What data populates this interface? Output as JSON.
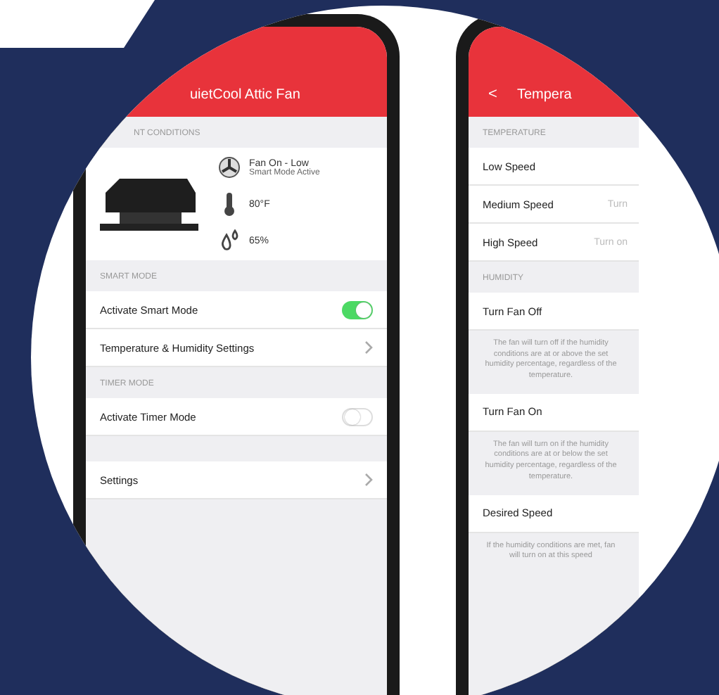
{
  "left_phone": {
    "title": "uietCool Attic Fan",
    "conditions": {
      "header": "NT CONDITIONS",
      "status": "Fan On - Low",
      "mode": "Smart Mode Active",
      "temperature": "80°F",
      "humidity": "65%"
    },
    "sections": [
      {
        "header": "SMART MODE",
        "rows": [
          {
            "kind": "toggle",
            "label": "Activate Smart Mode",
            "on": true
          },
          {
            "kind": "link",
            "label": "Temperature & Humidity Settings"
          }
        ]
      },
      {
        "header": "TIMER MODE",
        "rows": [
          {
            "kind": "toggle",
            "label": "Activate Timer Mode",
            "on": false
          }
        ]
      },
      {
        "rows": [
          {
            "kind": "link",
            "label": "Settings"
          }
        ]
      }
    ]
  },
  "right_phone": {
    "back": "<",
    "title": "Tempera",
    "sections": [
      {
        "header": "TEMPERATURE",
        "rows": [
          {
            "label": "Low Speed"
          },
          {
            "label": "Medium Speed",
            "value": "Turn"
          },
          {
            "label": "High Speed",
            "value": "Turn on"
          }
        ]
      },
      {
        "header": "HUMIDITY",
        "rows": [
          {
            "label": "Turn Fan Off",
            "note": "The fan will turn off if the humidity conditions are at or above the set humidity percentage, regardless of the temperature."
          },
          {
            "label": "Turn Fan On",
            "note": "The fan will turn on if the humidity conditions are at or below the set humidity percentage, regardless of the temperature."
          },
          {
            "label": "Desired Speed",
            "note": "If the humidity conditions are met, fan will turn on at this speed"
          }
        ]
      }
    ]
  }
}
